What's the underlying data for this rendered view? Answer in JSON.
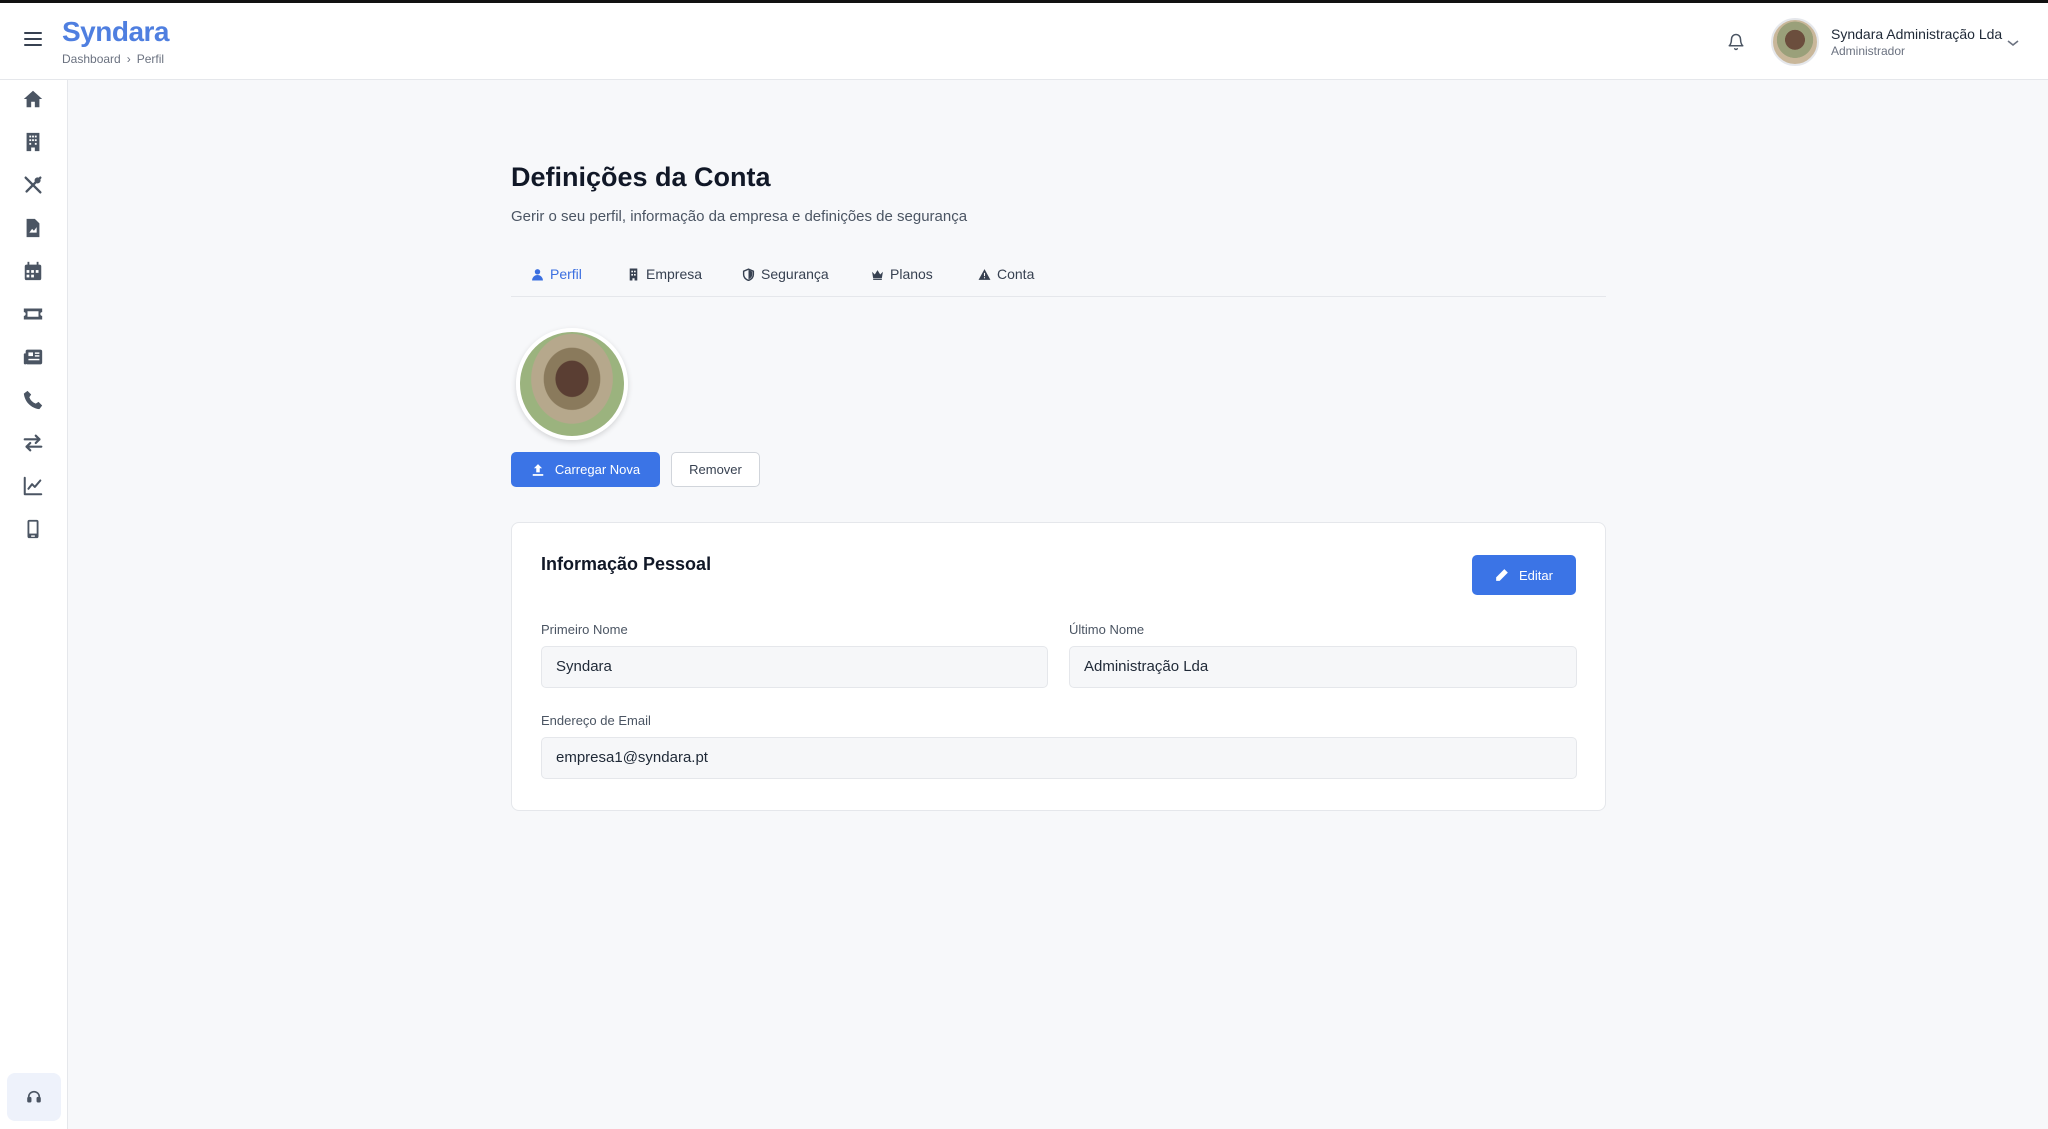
{
  "header": {
    "brand": "Syndara",
    "breadcrumb": [
      "Dashboard",
      "Perfil"
    ],
    "user_name": "Syndara Administração Lda",
    "user_role": "Administrador"
  },
  "sidebar": {
    "icons": [
      "home-icon",
      "building-icon",
      "tools-icon",
      "document-icon",
      "calendar-icon",
      "ticket-icon",
      "newspaper-icon",
      "phone-icon",
      "transfer-icon",
      "chart-icon",
      "mobile-icon",
      "support-icon"
    ]
  },
  "page": {
    "title": "Definições da Conta",
    "subtitle": "Gerir o seu perfil, informação da empresa e definições de segurança"
  },
  "tabs": [
    {
      "label": "Perfil",
      "icon": "user-icon",
      "active": true
    },
    {
      "label": "Empresa",
      "icon": "building-icon",
      "active": false
    },
    {
      "label": "Segurança",
      "icon": "shield-icon",
      "active": false
    },
    {
      "label": "Planos",
      "icon": "crown-icon",
      "active": false
    },
    {
      "label": "Conta",
      "icon": "warning-icon",
      "active": false
    }
  ],
  "avatar_actions": {
    "upload_label": "Carregar Nova",
    "remove_label": "Remover"
  },
  "personal_info": {
    "title": "Informação Pessoal",
    "edit_label": "Editar",
    "first_name_label": "Primeiro Nome",
    "first_name_value": "Syndara",
    "last_name_label": "Último Nome",
    "last_name_value": "Administração Lda",
    "email_label": "Endereço de Email",
    "email_value": "empresa1@syndara.pt"
  },
  "colors": {
    "accent": "#3b74e6",
    "brand": "#4f7fe0",
    "background": "#f7f8fa"
  }
}
